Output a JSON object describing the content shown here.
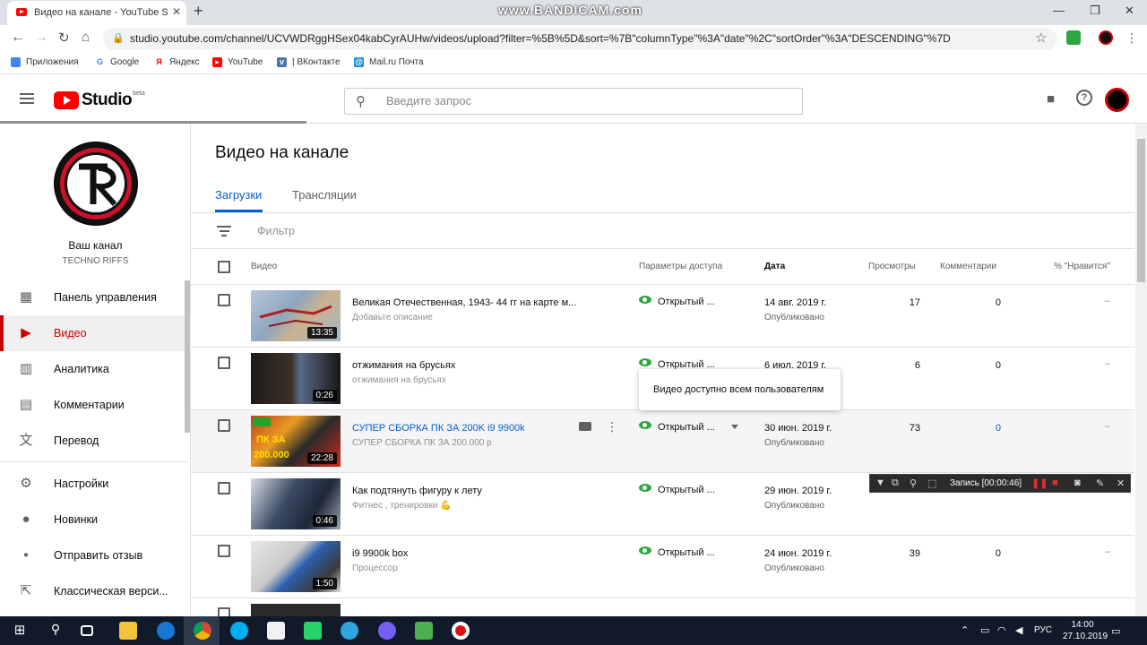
{
  "browser": {
    "tab_title": "Видео на канале - YouTube Studio",
    "tab_close": "✕",
    "new_tab": "+",
    "watermark": "www.BANDICAM.com",
    "url": "studio.youtube.com/channel/UCVWDRggHSex04kabCyrAUHw/videos/upload?filter=%5B%5D&sort=%7B\"columnType\"%3A\"date\"%2C\"sortOrder\"%3A\"DESCENDING\"%7D",
    "bookmarks": [
      {
        "label": "Приложения",
        "icon": "apps-icon",
        "color": "#4285f4"
      },
      {
        "label": "Google",
        "icon": "google-icon",
        "color": "#4285f4"
      },
      {
        "label": "Яндекс",
        "icon": "yandex-icon",
        "color": "#ff0000"
      },
      {
        "label": "YouTube",
        "icon": "youtube-icon",
        "color": "#ff0000"
      },
      {
        "label": "| ВКонтакте",
        "icon": "vk-icon",
        "color": "#4a76a8"
      },
      {
        "label": "Mail.ru Почта",
        "icon": "mailru-icon",
        "color": "#168de2"
      }
    ]
  },
  "studio": {
    "logo_text": "Studio",
    "beta": "beta",
    "search_placeholder": "Введите запрос"
  },
  "sidebar": {
    "channel_name": "Ваш канал",
    "channel_sub": "TECHNO RIFFS",
    "items": [
      {
        "label": "Панель управления",
        "icon": "dashboard-icon",
        "glyph": "▦"
      },
      {
        "label": "Видео",
        "icon": "video-icon",
        "glyph": "▶"
      },
      {
        "label": "Аналитика",
        "icon": "analytics-icon",
        "glyph": "▥"
      },
      {
        "label": "Комментарии",
        "icon": "comments-icon",
        "glyph": "▤"
      },
      {
        "label": "Перевод",
        "icon": "translate-icon",
        "glyph": "文"
      },
      {
        "label": "Настройки",
        "icon": "settings-icon",
        "glyph": "⚙"
      },
      {
        "label": "Новинки",
        "icon": "whats-new-icon",
        "glyph": "●"
      },
      {
        "label": "Отправить отзыв",
        "icon": "feedback-icon",
        "glyph": "▪"
      },
      {
        "label": "Классическая верси...",
        "icon": "classic-icon",
        "glyph": "⇱"
      }
    ]
  },
  "main": {
    "title": "Видео на канале",
    "tabs": [
      "Загрузки",
      "Трансляции"
    ],
    "filter_placeholder": "Фильтр",
    "columns": {
      "video": "Видео",
      "visibility": "Параметры доступа",
      "date": "Дата",
      "views": "Просмотры",
      "comments": "Комментарии",
      "likes": "% \"Нравится\""
    },
    "rows": [
      {
        "title": "Великая Отечественная, 1943- 44 гг на карте м...",
        "desc": "Добавьте описание",
        "duration": "13:35",
        "visibility": "Открытый ...",
        "date": "14 авг. 2019 г.",
        "status": "Опубликовано",
        "views": "17",
        "comments": "0",
        "likes": "–"
      },
      {
        "title": "отжимания на брусьях",
        "desc": "отжимания на брусьях",
        "duration": "0:26",
        "visibility": "Открытый ...",
        "date": "6 июл. 2019 г.",
        "status": "",
        "views": "6",
        "comments": "0",
        "likes": "–"
      },
      {
        "title": "СУПЕР СБОРКА ПК ЗА 200K i9 9900k",
        "desc": "СУПЕР СБОРКА ПК ЗА 200.000 р",
        "duration": "22:28",
        "visibility": "Открытый ...",
        "date": "30 июн. 2019 г.",
        "status": "Опубликовано",
        "views": "73",
        "comments": "0",
        "likes": "–"
      },
      {
        "title": "Как подтянуть фигуру к лету",
        "desc": "Фитнес , тренировки 💪",
        "duration": "0:46",
        "visibility": "Открытый ...",
        "date": "29 июн. 2019 г.",
        "status": "Опубликовано",
        "views": "",
        "comments": "",
        "likes": "–"
      },
      {
        "title": "i9 9900k box",
        "desc": "Процессор",
        "duration": "1:50",
        "visibility": "Открытый ...",
        "date": "24 июн. 2019 г.",
        "status": "Опубликовано",
        "views": "39",
        "comments": "0",
        "likes": "–"
      }
    ],
    "tooltip": "Видео доступно всем пользователям"
  },
  "recorder": {
    "label": "Запись [00:00:46]"
  },
  "taskbar": {
    "lang": "РУС",
    "time": "14:00",
    "date": "27.10.2019"
  }
}
